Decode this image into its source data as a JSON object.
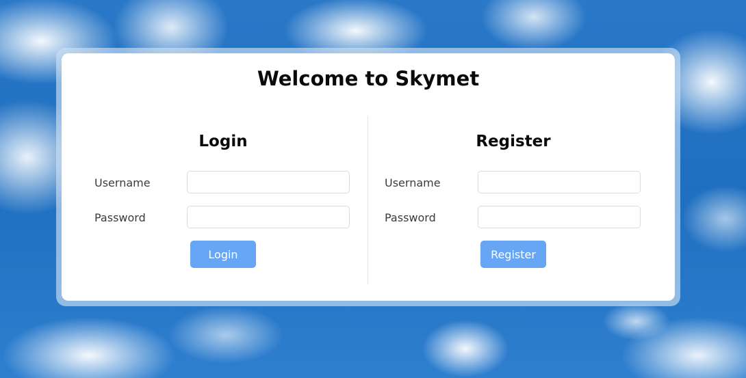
{
  "colors": {
    "sky_background": "#1f6fc0",
    "card": "#ffffff",
    "button": "#66a6f5",
    "button_text": "#ffffff"
  },
  "header": {
    "title": "Welcome to Skymet"
  },
  "login": {
    "heading": "Login",
    "username_label": "Username",
    "username_value": "",
    "password_label": "Password",
    "password_value": "",
    "button_label": "Login"
  },
  "register": {
    "heading": "Register",
    "username_label": "Username",
    "username_value": "",
    "password_label": "Password",
    "password_value": "",
    "button_label": "Register"
  }
}
